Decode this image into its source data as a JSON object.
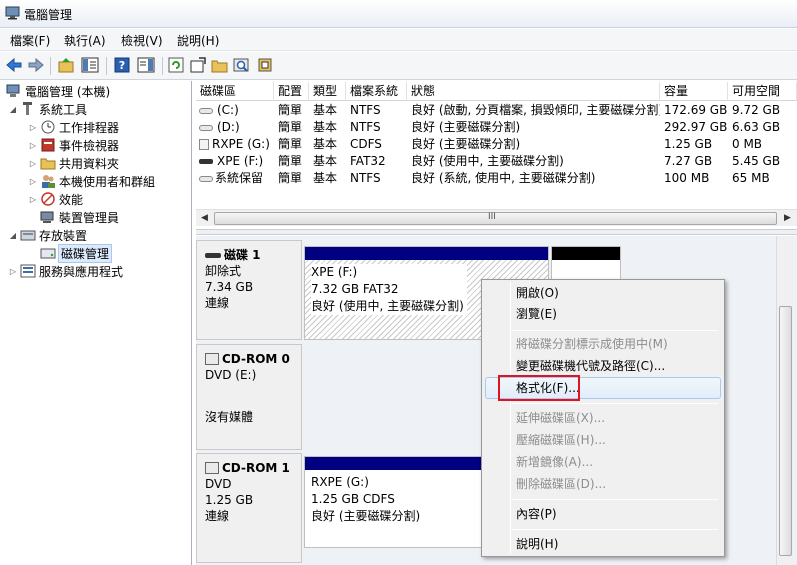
{
  "window": {
    "title": "電腦管理"
  },
  "menu": [
    "檔案(F)",
    "執行(A)",
    "檢視(V)",
    "說明(H)"
  ],
  "toolbar": {
    "buttons": [
      "back-icon",
      "forward-icon",
      "up-folder-icon",
      "show-hide-tree-icon",
      "help-icon",
      "properties-pane-icon",
      "refresh-icon",
      "settings-icon",
      "open-folder-icon",
      "search-icon",
      "export-icon"
    ]
  },
  "tree": {
    "root": "電腦管理 (本機)",
    "system_tools": "系統工具",
    "task_scheduler": "工作排程器",
    "event_viewer": "事件檢視器",
    "shared_folders": "共用資料夾",
    "local_users": "本機使用者和群組",
    "performance": "效能",
    "device_manager": "裝置管理員",
    "storage": "存放裝置",
    "disk_management": "磁碟管理",
    "services": "服務與應用程式"
  },
  "volume_table": {
    "headers": [
      "磁碟區",
      "配置",
      "類型",
      "檔案系統",
      "狀態",
      "容量",
      "可用空間"
    ],
    "rows": [
      [
        "(C:)",
        "簡單",
        "基本",
        "NTFS",
        "良好 (啟動, 分頁檔案, 損毀傾印, 主要磁碟分割)",
        "172.69 GB",
        "9.72 GB"
      ],
      [
        "(D:)",
        "簡單",
        "基本",
        "NTFS",
        "良好 (主要磁碟分割)",
        "292.97 GB",
        "6.63 GB"
      ],
      [
        "RXPE (G:)",
        "簡單",
        "基本",
        "CDFS",
        "良好 (主要磁碟分割)",
        "1.25 GB",
        "0 MB"
      ],
      [
        "XPE (F:)",
        "簡單",
        "基本",
        "FAT32",
        "良好 (使用中, 主要磁碟分割)",
        "7.27 GB",
        "5.45 GB"
      ],
      [
        "系統保留",
        "簡單",
        "基本",
        "NTFS",
        "良好 (系統, 使用中, 主要磁碟分割)",
        "100 MB",
        "65 MB"
      ]
    ],
    "scroll_grip": "III"
  },
  "disks": [
    {
      "name": "磁碟 1",
      "type": "卸除式",
      "size": "7.34 GB",
      "status": "連線",
      "volume": {
        "name": "XPE  (F:)",
        "info": "7.32 GB FAT32",
        "status": "良好 (使用中, 主要磁碟分割)"
      }
    },
    {
      "name": "CD-ROM 0",
      "type": "DVD (E:)",
      "size": "",
      "status": "沒有媒體"
    },
    {
      "name": "CD-ROM 1",
      "type": "DVD",
      "size": "1.25 GB",
      "status": "連線",
      "volume": {
        "name": "RXPE  (G:)",
        "info": "1.25 GB CDFS",
        "status": "良好 (主要磁碟分割)"
      }
    }
  ],
  "context_menu": {
    "open": "開啟(O)",
    "explore": "瀏覽(E)",
    "mark_active": "將磁碟分割標示成使用中(M)",
    "change_letter": "變更磁碟機代號及路徑(C)...",
    "format": "格式化(F)...",
    "extend": "延伸磁碟區(X)...",
    "shrink": "壓縮磁碟區(H)...",
    "add_mirror": "新增鏡像(A)...",
    "delete": "刪除磁碟區(D)...",
    "properties": "內容(P)",
    "help": "說明(H)"
  },
  "colors": {
    "primary_partition": "#000080",
    "unallocated": "#000000",
    "highlight_box": "#e0141e"
  }
}
